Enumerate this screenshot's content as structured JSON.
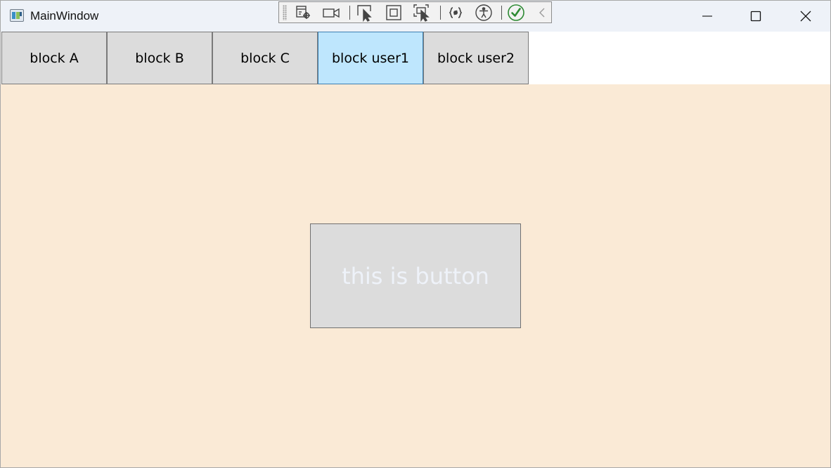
{
  "window": {
    "title": "MainWindow",
    "controls": [
      "minimize-icon",
      "maximize-icon",
      "close-icon"
    ]
  },
  "debug_toolbar": {
    "tools": [
      "visual-tree-icon",
      "record-icon",
      "select-element-icon",
      "display-layout-adorners-icon",
      "track-focus-icon",
      "binding-failures-icon",
      "accessibility-icon",
      "checkmark-icon",
      "collapse-chevron-icon"
    ]
  },
  "tabs": [
    {
      "label": "block A",
      "active": false
    },
    {
      "label": "block B",
      "active": false
    },
    {
      "label": "block C",
      "active": false
    },
    {
      "label": "block user1",
      "active": true
    },
    {
      "label": "block user2",
      "active": false
    }
  ],
  "content": {
    "button_label": "this is button",
    "background_color": "#faead6",
    "button_text_color": "#eef2f9"
  },
  "colors": {
    "tab_default": "#dcdcdc",
    "tab_active": "#bee6fd",
    "titlebar": "#eef2f8"
  }
}
